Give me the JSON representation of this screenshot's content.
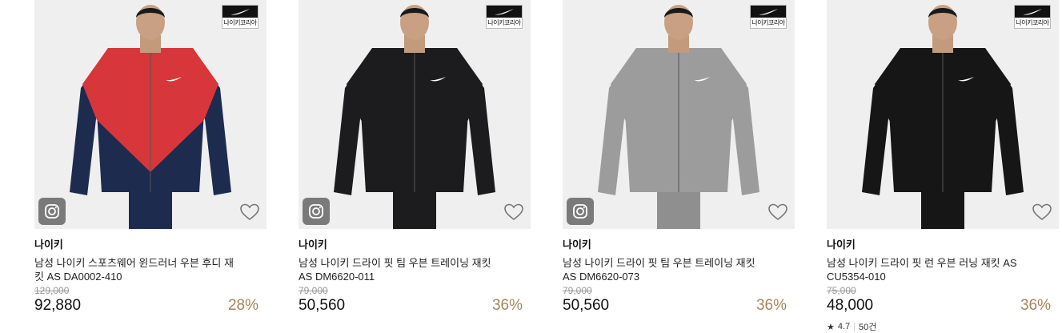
{
  "products": [
    {
      "badge_text": "나이키코리아",
      "brand": "나이키",
      "name": "남성 나이키 스포츠웨어 윈드러너 우븐 후디 재킷 AS DA0002-410",
      "original_price": "129,000",
      "sale_price": "92,880",
      "discount": "28%",
      "jacket_colors": {
        "upper": "#d7363a",
        "lower": "#1d2b4f",
        "pants": "#1d2b4f"
      },
      "has_instagram": true
    },
    {
      "badge_text": "나이키코리아",
      "brand": "나이키",
      "name": "남성 나이키 드라이 핏 팀 우븐 트레이닝 재킷 AS DM6620-011",
      "original_price": "79,000",
      "sale_price": "50,560",
      "discount": "36%",
      "jacket_colors": {
        "upper": "#1c1c1e",
        "lower": "#1c1c1e",
        "pants": "#1c1c1e"
      },
      "has_instagram": true
    },
    {
      "badge_text": "나이키코리아",
      "brand": "나이키",
      "name": "남성 나이키 드라이 핏 팀 우븐 트레이닝 재킷 AS DM6620-073",
      "original_price": "79,000",
      "sale_price": "50,560",
      "discount": "36%",
      "jacket_colors": {
        "upper": "#9c9c9c",
        "lower": "#9c9c9c",
        "pants": "#8f8f8f"
      },
      "has_instagram": true
    },
    {
      "badge_text": "나이키코리아",
      "brand": "나이키",
      "name": "남성 나이키 드라이 핏 런 우븐 러닝 재킷 AS CU5354-010",
      "original_price": "75,000",
      "sale_price": "48,000",
      "discount": "36%",
      "jacket_colors": {
        "upper": "#161616",
        "lower": "#161616",
        "pants": "#161616"
      },
      "has_instagram": false,
      "rating": "4.7",
      "review_count": "50건"
    }
  ],
  "icons": {
    "instagram": "instagram-icon",
    "wishlist": "heart-icon",
    "brand_logo": "swoosh-logo",
    "star": "star-icon"
  }
}
